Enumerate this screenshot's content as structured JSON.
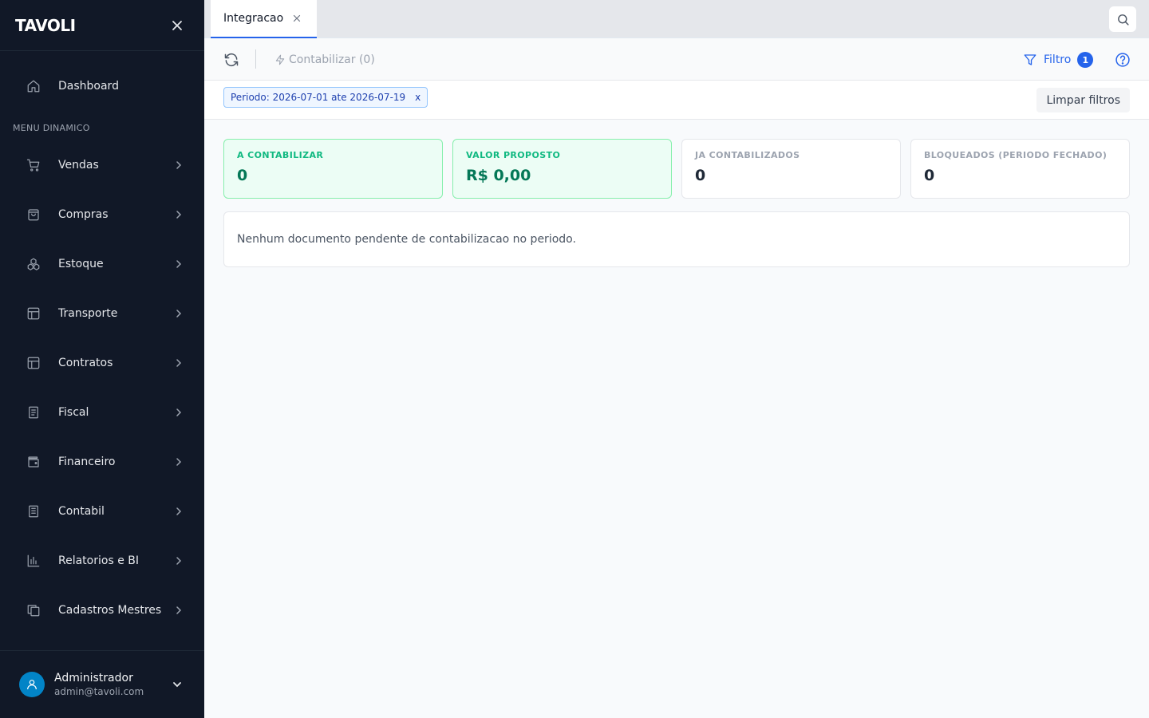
{
  "sidebar": {
    "logo": "TAVOLI",
    "dashboard_label": "Dashboard",
    "section_label": "MENU DINAMICO",
    "items": [
      {
        "label": "Vendas",
        "icon": "cart-icon"
      },
      {
        "label": "Compras",
        "icon": "shopping-bag-icon"
      },
      {
        "label": "Estoque",
        "icon": "boxes-icon"
      },
      {
        "label": "Transporte",
        "icon": "layout-icon"
      },
      {
        "label": "Contratos",
        "icon": "layout-icon"
      },
      {
        "label": "Fiscal",
        "icon": "receipt-icon"
      },
      {
        "label": "Financeiro",
        "icon": "wallet-icon"
      },
      {
        "label": "Contabil",
        "icon": "notebook-icon"
      },
      {
        "label": "Relatorios e BI",
        "icon": "bar-chart-icon"
      },
      {
        "label": "Cadastros Mestres",
        "icon": "copy-icon"
      }
    ],
    "user": {
      "name": "Administrador",
      "email": "admin@tavoli.com"
    }
  },
  "tabs": [
    {
      "label": "Integracao",
      "active": true
    }
  ],
  "toolbar": {
    "contabilizar_label": "Contabilizar (0)",
    "filter_label": "Filtro",
    "filter_count": "1"
  },
  "filters": {
    "chip_label": "Periodo: 2026-07-01 ate 2026-07-19",
    "chip_remove": "x",
    "clear_label": "Limpar filtros"
  },
  "cards": [
    {
      "label": "A CONTABILIZAR",
      "value": "0",
      "highlight": true
    },
    {
      "label": "VALOR PROPOSTO",
      "value": "R$ 0,00",
      "highlight": true
    },
    {
      "label": "JA CONTABILIZADOS",
      "value": "0",
      "highlight": false
    },
    {
      "label": "BLOQUEADOS (PERIODO FECHADO)",
      "value": "0",
      "highlight": false
    }
  ],
  "empty_message": "Nenhum documento pendente de contabilizacao no periodo.",
  "colors": {
    "sidebar_bg": "#111827",
    "accent": "#2563eb",
    "success": "#10b981",
    "success_bg": "#ecfdf5"
  }
}
